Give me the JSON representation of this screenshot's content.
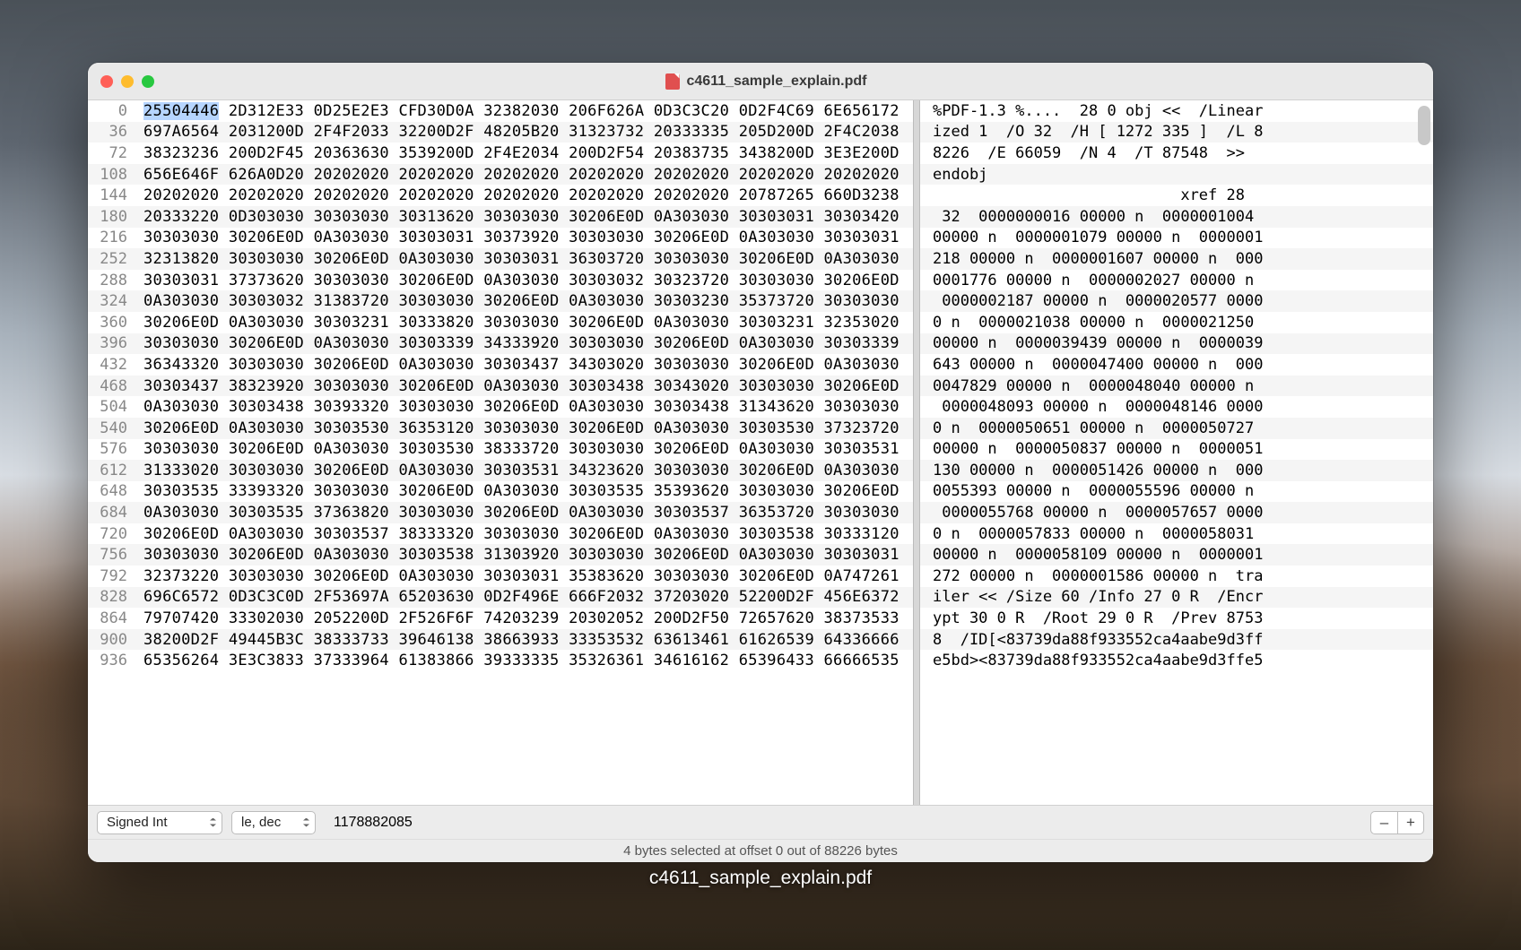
{
  "window": {
    "title": "c4611_sample_explain.pdf"
  },
  "dock_label": "c4611_sample_explain.pdf",
  "rows": [
    {
      "off": "0",
      "hex_first": "25504446",
      "hex_rest": " 2D312E33 0D25E2E3 CFD30D0A 32382030 206F626A 0D3C3C20 0D2F4C69 6E656172",
      "asc": "%PDF-1.3 %....  28 0 obj <<  /Linear"
    },
    {
      "off": "36",
      "hex_first": "697A6564",
      "hex_rest": " 2031200D 2F4F2033 32200D2F 48205B20 31323732 20333335 205D200D 2F4C2038",
      "asc": "ized 1  /O 32  /H [ 1272 335 ]  /L 8"
    },
    {
      "off": "72",
      "hex_first": "38323236",
      "hex_rest": " 200D2F45 20363630 3539200D 2F4E2034 200D2F54 20383735 3438200D 3E3E200D",
      "asc": "8226  /E 66059  /N 4  /T 87548  >>  "
    },
    {
      "off": "108",
      "hex_first": "656E646F",
      "hex_rest": " 626A0D20 20202020 20202020 20202020 20202020 20202020 20202020 20202020",
      "asc": "endobj                              "
    },
    {
      "off": "144",
      "hex_first": "20202020",
      "hex_rest": " 20202020 20202020 20202020 20202020 20202020 20202020 20787265 660D3238",
      "asc": "                           xref 28  "
    },
    {
      "off": "180",
      "hex_first": "20333220",
      "hex_rest": " 0D303030 30303030 30313620 30303030 30206E0D 0A303030 30303031 30303420",
      "asc": " 32  0000000016 00000 n  0000001004 "
    },
    {
      "off": "216",
      "hex_first": "30303030",
      "hex_rest": " 30206E0D 0A303030 30303031 30373920 30303030 30206E0D 0A303030 30303031",
      "asc": "00000 n  0000001079 00000 n  0000001"
    },
    {
      "off": "252",
      "hex_first": "32313820",
      "hex_rest": " 30303030 30206E0D 0A303030 30303031 36303720 30303030 30206E0D 0A303030",
      "asc": "218 00000 n  0000001607 00000 n  000"
    },
    {
      "off": "288",
      "hex_first": "30303031",
      "hex_rest": " 37373620 30303030 30206E0D 0A303030 30303032 30323720 30303030 30206E0D",
      "asc": "0001776 00000 n  0000002027 00000 n "
    },
    {
      "off": "324",
      "hex_first": "0A303030",
      "hex_rest": " 30303032 31383720 30303030 30206E0D 0A303030 30303230 35373720 30303030",
      "asc": " 0000002187 00000 n  0000020577 0000"
    },
    {
      "off": "360",
      "hex_first": "30206E0D",
      "hex_rest": " 0A303030 30303231 30333820 30303030 30206E0D 0A303030 30303231 32353020",
      "asc": "0 n  0000021038 00000 n  0000021250 "
    },
    {
      "off": "396",
      "hex_first": "30303030",
      "hex_rest": " 30206E0D 0A303030 30303339 34333920 30303030 30206E0D 0A303030 30303339",
      "asc": "00000 n  0000039439 00000 n  0000039"
    },
    {
      "off": "432",
      "hex_first": "36343320",
      "hex_rest": " 30303030 30206E0D 0A303030 30303437 34303020 30303030 30206E0D 0A303030",
      "asc": "643 00000 n  0000047400 00000 n  000"
    },
    {
      "off": "468",
      "hex_first": "30303437",
      "hex_rest": " 38323920 30303030 30206E0D 0A303030 30303438 30343020 30303030 30206E0D",
      "asc": "0047829 00000 n  0000048040 00000 n "
    },
    {
      "off": "504",
      "hex_first": "0A303030",
      "hex_rest": " 30303438 30393320 30303030 30206E0D 0A303030 30303438 31343620 30303030",
      "asc": " 0000048093 00000 n  0000048146 0000"
    },
    {
      "off": "540",
      "hex_first": "30206E0D",
      "hex_rest": " 0A303030 30303530 36353120 30303030 30206E0D 0A303030 30303530 37323720",
      "asc": "0 n  0000050651 00000 n  0000050727 "
    },
    {
      "off": "576",
      "hex_first": "30303030",
      "hex_rest": " 30206E0D 0A303030 30303530 38333720 30303030 30206E0D 0A303030 30303531",
      "asc": "00000 n  0000050837 00000 n  0000051"
    },
    {
      "off": "612",
      "hex_first": "31333020",
      "hex_rest": " 30303030 30206E0D 0A303030 30303531 34323620 30303030 30206E0D 0A303030",
      "asc": "130 00000 n  0000051426 00000 n  000"
    },
    {
      "off": "648",
      "hex_first": "30303535",
      "hex_rest": " 33393320 30303030 30206E0D 0A303030 30303535 35393620 30303030 30206E0D",
      "asc": "0055393 00000 n  0000055596 00000 n "
    },
    {
      "off": "684",
      "hex_first": "0A303030",
      "hex_rest": " 30303535 37363820 30303030 30206E0D 0A303030 30303537 36353720 30303030",
      "asc": " 0000055768 00000 n  0000057657 0000"
    },
    {
      "off": "720",
      "hex_first": "30206E0D",
      "hex_rest": " 0A303030 30303537 38333320 30303030 30206E0D 0A303030 30303538 30333120",
      "asc": "0 n  0000057833 00000 n  0000058031 "
    },
    {
      "off": "756",
      "hex_first": "30303030",
      "hex_rest": " 30206E0D 0A303030 30303538 31303920 30303030 30206E0D 0A303030 30303031",
      "asc": "00000 n  0000058109 00000 n  0000001"
    },
    {
      "off": "792",
      "hex_first": "32373220",
      "hex_rest": " 30303030 30206E0D 0A303030 30303031 35383620 30303030 30206E0D 0A747261",
      "asc": "272 00000 n  0000001586 00000 n  tra"
    },
    {
      "off": "828",
      "hex_first": "696C6572",
      "hex_rest": " 0D3C3C0D 2F53697A 65203630 0D2F496E 666F2032 37203020 52200D2F 456E6372",
      "asc": "iler << /Size 60 /Info 27 0 R  /Encr"
    },
    {
      "off": "864",
      "hex_first": "79707420",
      "hex_rest": " 33302030 2052200D 2F526F6F 74203239 20302052 200D2F50 72657620 38373533",
      "asc": "ypt 30 0 R  /Root 29 0 R  /Prev 8753"
    },
    {
      "off": "900",
      "hex_first": "38200D2F",
      "hex_rest": " 49445B3C 38333733 39646138 38663933 33353532 63613461 61626539 64336666",
      "asc": "8  /ID[<83739da88f933552ca4aabe9d3ff"
    },
    {
      "off": "936",
      "hex_first": "65356264",
      "hex_rest": " 3E3C3833 37333964 61383866 39333335 35326361 34616162 65396433 66666535",
      "asc": "e5bd><83739da88f933552ca4aabe9d3ffe5"
    }
  ],
  "bottom": {
    "format_select": "Signed Int",
    "endian_select": "le, dec",
    "value": "1178882085",
    "minus": "–",
    "plus": "+"
  },
  "status": "4 bytes selected at offset 0 out of 88226 bytes"
}
